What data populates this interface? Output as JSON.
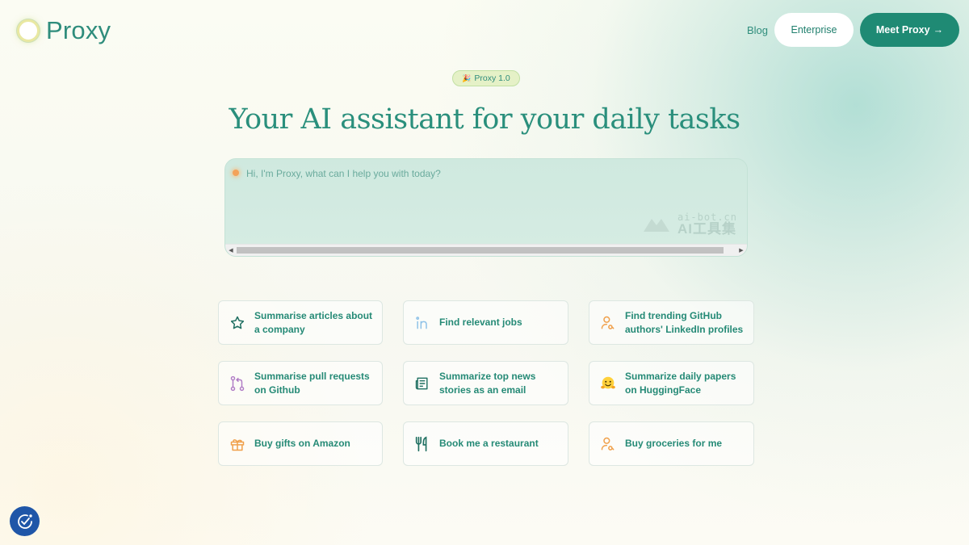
{
  "header": {
    "logo_text": "Proxy",
    "nav": {
      "blog": "Blog",
      "enterprise": "Enterprise",
      "meet": "Meet Proxy",
      "meet_arrow": "→"
    }
  },
  "hero": {
    "badge_emoji": "🎉",
    "badge": "Proxy 1.0",
    "headline": "Your AI assistant for your daily tasks"
  },
  "prompt": {
    "placeholder": "Hi, I'm Proxy, what can I help you with today?",
    "value": ""
  },
  "watermark": {
    "top": "ai-bot.cn",
    "bottom": "AI工具集"
  },
  "suggestions": [
    {
      "label": "Summarise articles about a company",
      "icon": "star-icon"
    },
    {
      "label": "Find relevant jobs",
      "icon": "linkedin-icon"
    },
    {
      "label": "Find trending GitHub authors' LinkedIn profiles",
      "icon": "user-search-icon"
    },
    {
      "label": "Summarise pull requests on Github",
      "icon": "git-pull-request-icon"
    },
    {
      "label": "Summarize top news stories as an email",
      "icon": "newspaper-icon"
    },
    {
      "label": "Summarize daily papers on HuggingFace",
      "icon": "hugging-face-icon"
    },
    {
      "label": "Buy gifts on Amazon",
      "icon": "gift-icon"
    },
    {
      "label": "Book me a restaurant",
      "icon": "utensils-icon"
    },
    {
      "label": "Buy groceries for me",
      "icon": "user-search-icon"
    }
  ],
  "colors": {
    "brand": "#1f8a74",
    "text": "#258a76",
    "orange_icon": "#f0a04b",
    "purple_icon": "#b07cc6",
    "cookie_button": "#1f56a8"
  }
}
